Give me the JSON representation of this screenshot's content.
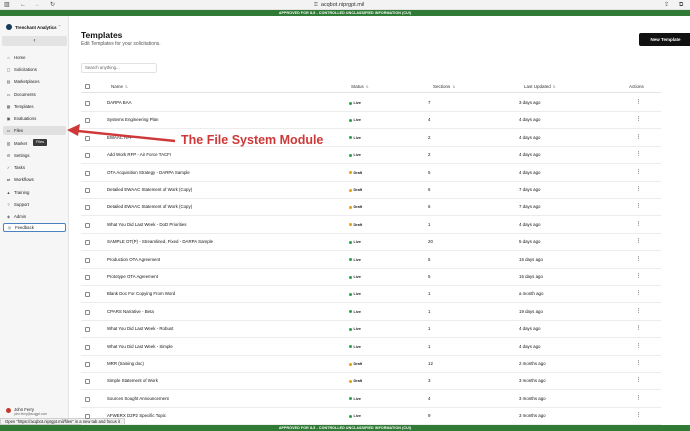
{
  "browser": {
    "url": "acqbot.niprgpt.mil",
    "banner": "APPROVED FOR IL5 - CONTROLLED UNCLASSIFIED INFORMATION (CUI)",
    "status_link": "Open \"https://acqbot.niprgpt.mil/files\" in a new tab and focus it"
  },
  "sidebar": {
    "org_name": "Trenchant Analytics",
    "collapse_icon": "chevron-left-icon",
    "items": [
      {
        "label": "Home",
        "icon": "home-icon"
      },
      {
        "label": "Solicitations",
        "icon": "document-icon"
      },
      {
        "label": "Marketplaces",
        "icon": "store-icon"
      },
      {
        "label": "Documents",
        "icon": "file-icon"
      },
      {
        "label": "Templates",
        "icon": "template-icon"
      },
      {
        "label": "Evaluations",
        "icon": "clipboard-icon"
      },
      {
        "label": "Files",
        "icon": "folder-icon"
      },
      {
        "label": "Market",
        "icon": "chart-icon"
      },
      {
        "label": "Settings",
        "icon": "gear-icon"
      },
      {
        "label": "Tasks",
        "icon": "check-icon"
      },
      {
        "label": "Workflows",
        "icon": "workflow-icon"
      },
      {
        "label": "Training",
        "icon": "graduation-icon"
      },
      {
        "label": "Support",
        "icon": "help-icon"
      },
      {
        "label": "Admin",
        "icon": "shield-icon"
      },
      {
        "label": "Feedback",
        "icon": "feedback-icon"
      }
    ],
    "tooltip": "Files",
    "user": {
      "name": "John Ferry",
      "email": "john.ferry@acqgpt.com"
    }
  },
  "header": {
    "title": "Templates",
    "subtitle": "Edit Templates for your solicitations.",
    "new_button": "New Template"
  },
  "search": {
    "placeholder": "Search anything..."
  },
  "table": {
    "columns": {
      "name": "Name",
      "status": "Status",
      "sections": "Sections",
      "updated": "Last Updated",
      "actions": "Actions"
    },
    "rows": [
      {
        "name": "DARPA BAA",
        "status": "Live",
        "sections": "7",
        "updated": "3 days ago"
      },
      {
        "name": "Systems Engineering Plan",
        "status": "Live",
        "sections": "4",
        "updated": "4 days ago"
      },
      {
        "name": "EWAAC RFP",
        "status": "Live",
        "sections": "2",
        "updated": "4 days ago"
      },
      {
        "name": "Add Work RFP - Air Force TACFI",
        "status": "Live",
        "sections": "2",
        "updated": "4 days ago"
      },
      {
        "name": "OTA Acquisition Strategy - DARPA Sample",
        "status": "Draft",
        "sections": "5",
        "updated": "4 days ago"
      },
      {
        "name": "Detailed EWAAC Statement of Work (Copy)",
        "status": "Draft",
        "sections": "6",
        "updated": "7 days ago"
      },
      {
        "name": "Detailed EWAAC Statement of Work (Copy)",
        "status": "Draft",
        "sections": "6",
        "updated": "7 days ago"
      },
      {
        "name": "What You Did Last Week - DoD Priorities",
        "status": "Draft",
        "sections": "1",
        "updated": "4 days ago"
      },
      {
        "name": "SAMPLE OT(P) - Streamlined, Fixed - DARPA Sample",
        "status": "Live",
        "sections": "20",
        "updated": "5 days ago"
      },
      {
        "name": "Production OTA Agreement",
        "status": "Live",
        "sections": "5",
        "updated": "15 days ago"
      },
      {
        "name": "Prototype OTA Agreement",
        "status": "Live",
        "sections": "5",
        "updated": "15 days ago"
      },
      {
        "name": "Blank Doc For Copying From Word",
        "status": "Live",
        "sections": "1",
        "updated": "a month ago"
      },
      {
        "name": "CPARS Narrative - Beta",
        "status": "Live",
        "sections": "1",
        "updated": "19 days ago"
      },
      {
        "name": "What You Did Last Week - Robust",
        "status": "Live",
        "sections": "1",
        "updated": "4 days ago"
      },
      {
        "name": "What You Did Last Week - Simple",
        "status": "Live",
        "sections": "1",
        "updated": "4 days ago"
      },
      {
        "name": "MRR (training doc)",
        "status": "Draft",
        "sections": "12",
        "updated": "2 months ago"
      },
      {
        "name": "Simple Statement of Work",
        "status": "Draft",
        "sections": "3",
        "updated": "3 months ago"
      },
      {
        "name": "Sources Sought Announcement",
        "status": "Live",
        "sections": "4",
        "updated": "3 months ago"
      },
      {
        "name": "AFWERX D2P2 Specific Topic",
        "status": "Live",
        "sections": "9",
        "updated": "3 months ago"
      }
    ]
  },
  "annotation": {
    "text": "The File System Module"
  },
  "colors": {
    "live": "#2e9e49",
    "draft": "#e0a11b",
    "arrow": "#cf3838",
    "banner": "#2f7a34"
  }
}
